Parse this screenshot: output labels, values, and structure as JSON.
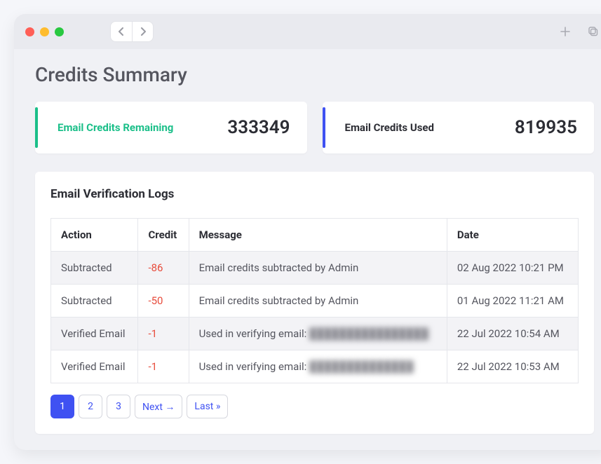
{
  "page": {
    "title": "Credits Summary"
  },
  "cards": {
    "remaining": {
      "label": "Email Credits Remaining",
      "value": "333349"
    },
    "used": {
      "label": "Email Credits Used",
      "value": "819935"
    }
  },
  "logs": {
    "title": "Email Verification Logs",
    "headers": {
      "action": "Action",
      "credit": "Credit",
      "message": "Message",
      "date": "Date"
    },
    "rows": [
      {
        "action": "Subtracted",
        "credit": "-86",
        "message": "Email credits subtracted by Admin",
        "redacted": "",
        "date": "02 Aug 2022 10:21 PM"
      },
      {
        "action": "Subtracted",
        "credit": "-50",
        "message": "Email credits subtracted by Admin",
        "redacted": "",
        "date": "01 Aug 2022 11:21 AM"
      },
      {
        "action": "Verified Email",
        "credit": "-1",
        "message": "Used in verifying email: ",
        "redacted": "████████████████",
        "date": "22 Jul 2022 10:54 AM"
      },
      {
        "action": "Verified Email",
        "credit": "-1",
        "message": "Used in verifying email: ",
        "redacted": "██████████████",
        "date": "22 Jul 2022 10:53 AM"
      }
    ]
  },
  "pagination": {
    "p1": "1",
    "p2": "2",
    "p3": "3",
    "next": "Next →",
    "last": "Last »"
  }
}
